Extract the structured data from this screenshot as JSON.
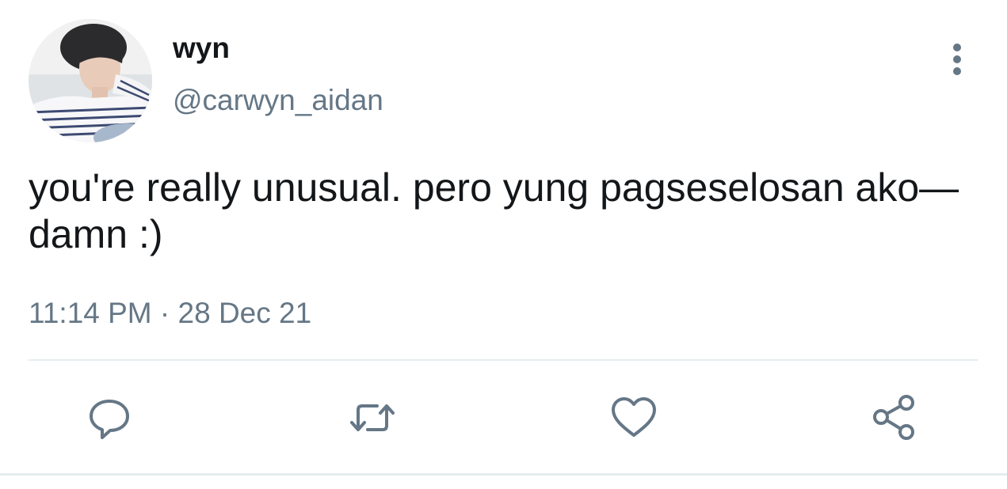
{
  "tweet": {
    "author": {
      "display_name": "wyn",
      "handle": "@carwyn_aidan"
    },
    "text": "you're really unusual. pero yung pagseselosan ako— damn :)",
    "time": "11:14 PM",
    "separator": "·",
    "date": "28 Dec 21"
  },
  "icons": {
    "menu": "more-vertical-icon",
    "reply": "reply-icon",
    "retweet": "retweet-icon",
    "like": "heart-icon",
    "share": "share-icon"
  },
  "colors": {
    "text_primary": "#14171a",
    "text_secondary": "#657786",
    "divider": "#e6ecf0"
  }
}
